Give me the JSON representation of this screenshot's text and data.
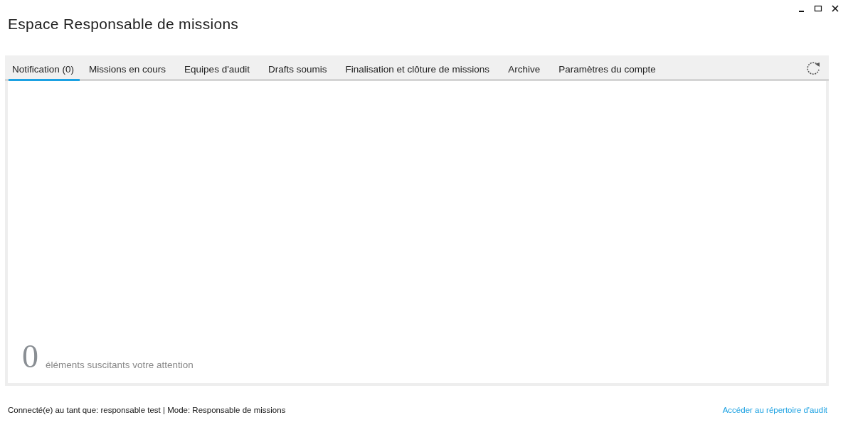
{
  "window": {
    "title": "Espace Responsable de missions"
  },
  "tabs": [
    {
      "label": "Notification (0)",
      "selected": true
    },
    {
      "label": "Missions en cours",
      "selected": false
    },
    {
      "label": "Equipes d'audit",
      "selected": false
    },
    {
      "label": "Drafts soumis",
      "selected": false
    },
    {
      "label": "Finalisation et clôture de missions",
      "selected": false
    },
    {
      "label": "Archive",
      "selected": false
    },
    {
      "label": "Paramètres du compte",
      "selected": false
    }
  ],
  "summary": {
    "count": "0",
    "label": "éléments suscitants votre attention"
  },
  "status_bar": {
    "text": "Connecté(e) au tant que: responsable test | Mode: Responsable de missions",
    "link": "Accéder au répertoire d'audit"
  }
}
